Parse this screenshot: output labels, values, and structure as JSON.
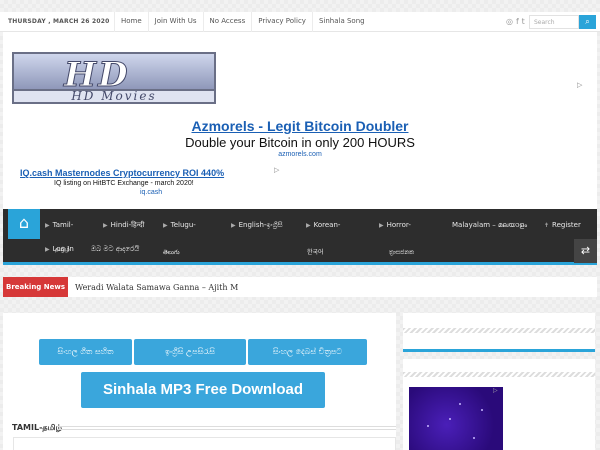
{
  "topbar": {
    "date": "THURSDAY , MARCH 26 2020",
    "nav": [
      "Home",
      "Join With Us",
      "No Access",
      "Privacy Policy",
      "Sinhala Song"
    ],
    "social_icons": [
      "rss-icon",
      "facebook-icon",
      "twitter-icon"
    ],
    "search_placeholder": "Search",
    "search_icon": "search-icon"
  },
  "header": {
    "logo_main": "HD",
    "logo_sub": "HD Movies"
  },
  "ads": {
    "ad1": {
      "title": "Azmorels - Legit Bitcoin Doubler",
      "description": "Double your Bitcoin in only 200 HOURS",
      "url": "azmorels.com"
    },
    "ad2": {
      "title": "IQ.cash Masternodes Cryptocurrency ROI 440%",
      "description": "IQ listing on HitBTC Exchange - march 2020!",
      "url": "iq.cash"
    },
    "adchoices_icon": "adchoices-icon"
  },
  "mainnav": {
    "home_icon": "home-icon",
    "items": [
      {
        "label": "Tamil-"
      },
      {
        "label": "Hindi-हिन्दी"
      },
      {
        "label": "Telugu-"
      },
      {
        "label": "English-ඉංග්‍රීසි"
      },
      {
        "label": "Korean-"
      },
      {
        "label": "Horror-"
      },
      {
        "label": "Malayalam – മലയാളം"
      },
      {
        "label": "Register"
      }
    ],
    "wrapped": {
      "tamil": "தமிழ்",
      "telugu": "తెలుగు",
      "korean": "한국어",
      "horror": "ත්‍රාසජනක",
      "login": "Log In",
      "extra": "ඔබ මට ආදරෙයි"
    },
    "shuffle_icon": "shuffle-icon"
  },
  "breaking": {
    "label": "Breaking News",
    "ticker": "Weradi Walata Samawa Ganna – Ajith M"
  },
  "content": {
    "category_buttons": [
      "සිංහල ගීත සහිත",
      "ඉංග්‍රීසි උපසිරැසි",
      "සිංහල දෙබස් චිත්‍රපට"
    ],
    "mp3_button": "Sinhala MP3 Free Download",
    "section_title": "TAMIL-தமிழ்"
  }
}
